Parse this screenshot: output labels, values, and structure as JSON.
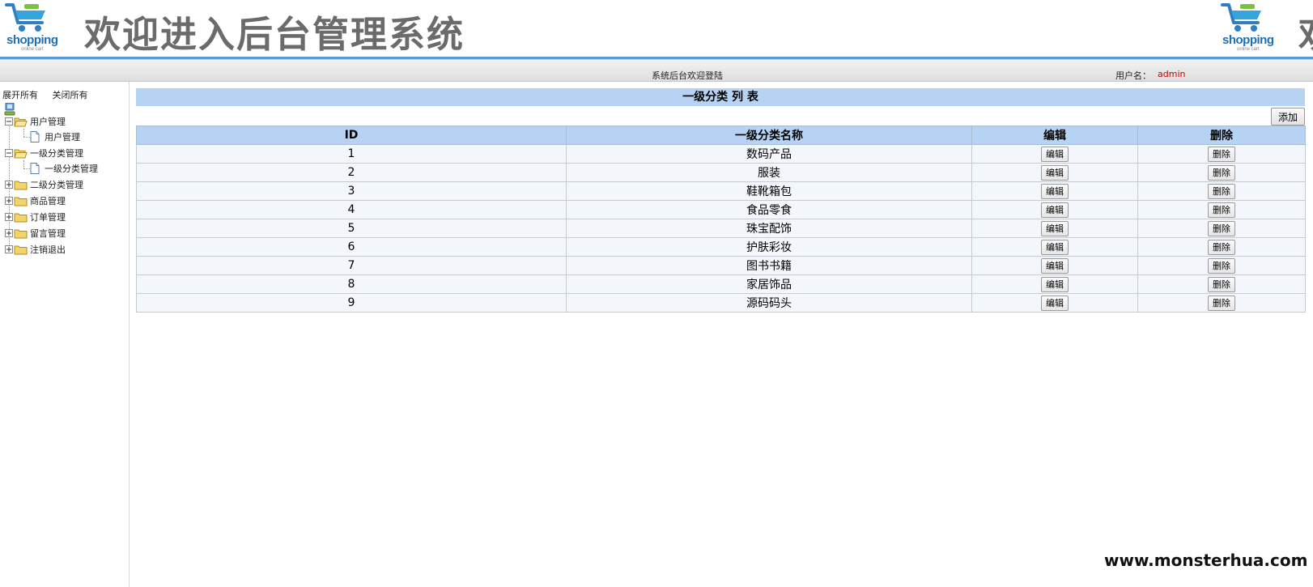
{
  "header": {
    "brand": "shopping",
    "brand_tagline": "online cart",
    "title": "欢迎进入后台管理系统",
    "title_cut": "欢"
  },
  "status_bar": {
    "welcome": "系统后台欢迎登陆",
    "user_label": "用户名：",
    "user_value": "admin"
  },
  "sidebar": {
    "expand_all": "展开所有",
    "collapse_all": "关闭所有",
    "tree": [
      {
        "label": "用户管理",
        "expanded": true,
        "children": [
          "用户管理"
        ]
      },
      {
        "label": "一级分类管理",
        "expanded": true,
        "children": [
          "一级分类管理"
        ]
      },
      {
        "label": "二级分类管理",
        "expanded": false
      },
      {
        "label": "商品管理",
        "expanded": false
      },
      {
        "label": "订单管理",
        "expanded": false
      },
      {
        "label": "留言管理",
        "expanded": false
      },
      {
        "label": "注销退出",
        "expanded": false
      }
    ]
  },
  "main": {
    "list_title": "一级分类 列 表",
    "add_label": "添加",
    "columns": [
      "ID",
      "一级分类名称",
      "编辑",
      "删除"
    ],
    "edit_label": "编辑",
    "delete_label": "删除",
    "rows": [
      {
        "id": "1",
        "name": "数码产品"
      },
      {
        "id": "2",
        "name": "服装"
      },
      {
        "id": "3",
        "name": "鞋靴箱包"
      },
      {
        "id": "4",
        "name": "食品零食"
      },
      {
        "id": "5",
        "name": "珠宝配饰"
      },
      {
        "id": "6",
        "name": "护肤彩妆"
      },
      {
        "id": "7",
        "name": "图书书籍"
      },
      {
        "id": "8",
        "name": "家居饰品"
      },
      {
        "id": "9",
        "name": "源码码头"
      }
    ]
  },
  "watermark": "www.monsterhua.com",
  "colors": {
    "header_line": "#5a9bd6",
    "table_header_bg": "#b7d3f3",
    "row_bg": "#f3f7fb",
    "user_value": "#cc0000",
    "title_gray": "#6b6b6b",
    "brand_blue": "#1d6fb8"
  },
  "icons": {
    "logo": "shopping-cart-icon",
    "tree_root": "computer-icon",
    "tree_folder": "folder-icon",
    "tree_leaf": "document-icon",
    "tree_toggle": "plus-minus-box-icon"
  }
}
